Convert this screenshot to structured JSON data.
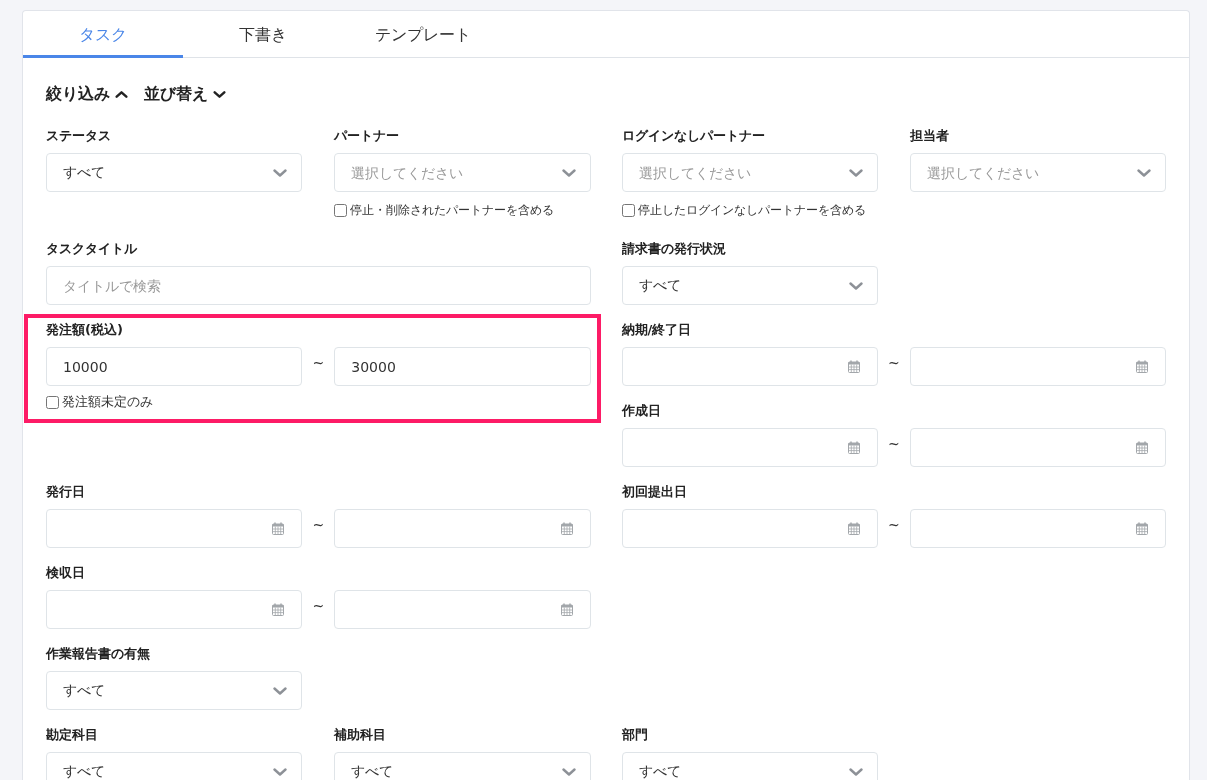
{
  "tabs": [
    {
      "label": "タスク",
      "selected": true
    },
    {
      "label": "下書き",
      "selected": false
    },
    {
      "label": "テンプレート",
      "selected": false
    }
  ],
  "toggles": [
    {
      "label": "絞り込み",
      "expanded": true
    },
    {
      "label": "並び替え",
      "expanded": false
    }
  ],
  "rows": [
    {
      "left": [
        {
          "kind": "select",
          "label": "ステータス",
          "value": "すべて"
        },
        {
          "kind": "select",
          "label": "パートナー",
          "placeholder": "選択してください",
          "option": {
            "label": "停止・削除されたパートナーを含める",
            "checked": false
          }
        }
      ],
      "right": [
        {
          "kind": "select",
          "label": "ログインなしパートナー",
          "placeholder": "選択してください",
          "option": {
            "label": "停止したログインなしパートナーを含める",
            "checked": false
          }
        },
        {
          "kind": "select",
          "label": "担当者",
          "placeholder": "選択してください"
        }
      ]
    },
    {
      "left": [
        {
          "kind": "text",
          "label": "タスクタイトル",
          "placeholder": "タイトルで検索"
        }
      ],
      "right": [
        {
          "kind": "select",
          "label": "請求書の発行状況",
          "value": "すべて"
        }
      ]
    },
    {
      "left": [
        {
          "kind": "number_range",
          "label": "発注額(税込)",
          "from": "10000",
          "separator": "~",
          "to": "30000",
          "option": {
            "label": "発注額未定のみ",
            "checked": false
          },
          "highlighted": true
        }
      ],
      "right": [
        {
          "kind": "date_range",
          "label": "納期/終了日",
          "separator": "~"
        },
        {
          "kind": "date_range",
          "label": "作成日",
          "separator": "~"
        }
      ]
    },
    {
      "left": [
        {
          "kind": "date_range",
          "label": "発行日",
          "separator": "~"
        }
      ],
      "right": [
        {
          "kind": "date_range",
          "label": "初回提出日",
          "separator": "~"
        }
      ]
    },
    {
      "left": [
        {
          "kind": "date_range",
          "label": "検収日",
          "separator": "~"
        }
      ]
    },
    {
      "left": [
        {
          "kind": "select",
          "label": "作業報告書の有無",
          "value": "すべて"
        }
      ]
    },
    {
      "left": [
        {
          "kind": "select",
          "label": "勘定科目",
          "value": "すべて"
        },
        {
          "kind": "select",
          "label": "補助科目",
          "value": "すべて"
        }
      ],
      "right": [
        {
          "kind": "select",
          "label": "部門",
          "value": "すべて"
        }
      ]
    }
  ]
}
